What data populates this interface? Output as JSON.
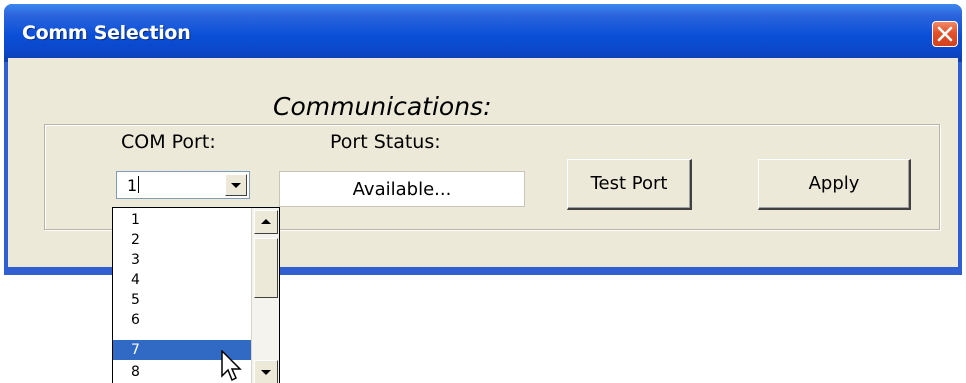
{
  "window": {
    "title": "Comm Selection",
    "close_icon": "close-x-icon"
  },
  "main": {
    "heading": "Communications:",
    "com_port_label": "COM Port:",
    "port_status_label": "Port Status:",
    "com_port_value": "1",
    "port_status_value": "Available...",
    "test_port_label": "Test Port",
    "apply_label": "Apply"
  },
  "dropdown": {
    "items": [
      "1",
      "2",
      "3",
      "4",
      "5",
      "6",
      "7",
      "8"
    ],
    "selected_item": "7"
  },
  "colors": {
    "titlebar": "#0a4fd8",
    "client_bg": "#ece9d8",
    "selection": "#316ac5",
    "close_button": "#e3512a"
  }
}
